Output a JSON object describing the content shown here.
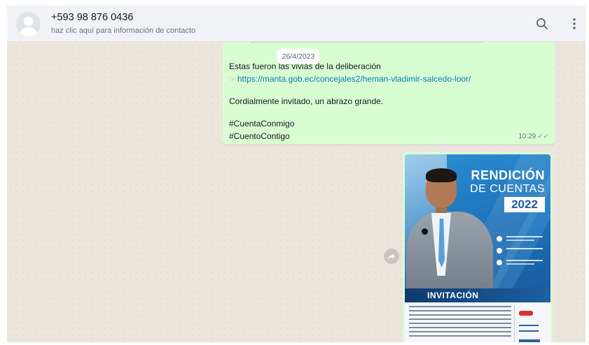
{
  "header": {
    "contact_name": "+593 98 876 0436",
    "contact_subtitle": "haz clic aquí para información de contacto",
    "search_icon": "search-icon",
    "menu_icon": "vertical-dots-icon"
  },
  "chat": {
    "date_pill": "26/4/2023",
    "message": {
      "line1": "Estas fueron las vivias de la deliberación",
      "link_icon": "pointing-hand-icon",
      "link": "https://manta.gob.ec/concejales2/heman-vladimir-salcedo-loor/",
      "line3": "Cordialmente invitado, un abrazo grande.",
      "line4": "#CuentaConmigo",
      "line5": "#CuentoContigo",
      "time": "10:29",
      "status_icon": "double-check-icon"
    },
    "forward_icon": "forward-icon",
    "image_message": {
      "poster_title_1": "RENDICIÓN",
      "poster_title_2": "DE CUENTAS",
      "poster_year": "2022",
      "poster_banner": "INVITACIÓN"
    }
  },
  "colors": {
    "outgoing_bubble": "#d9fdd3",
    "link": "#027eb5",
    "chat_background": "#ece5dd"
  }
}
